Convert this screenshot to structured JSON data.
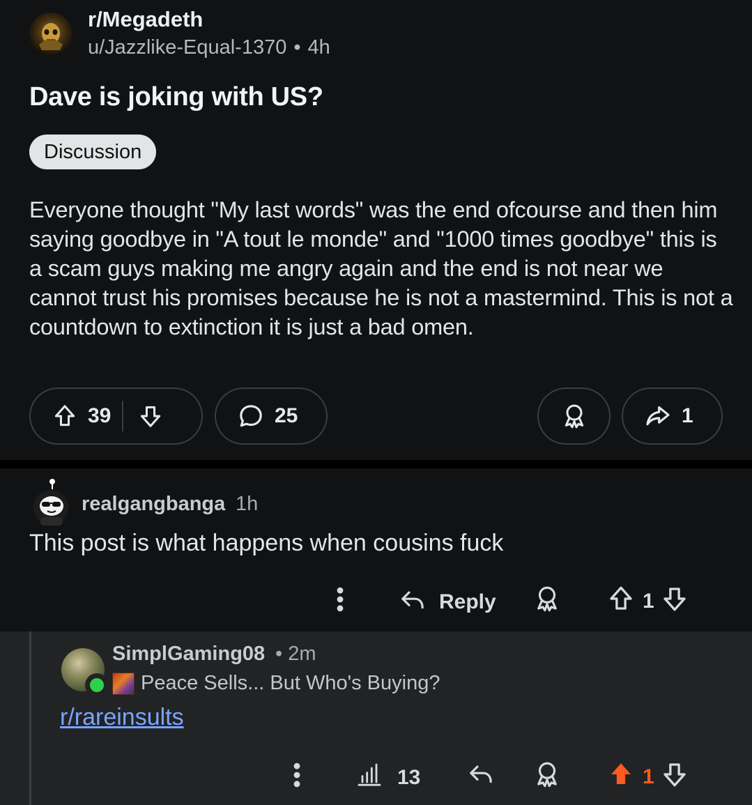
{
  "post": {
    "subreddit": "r/Megadeth",
    "author": "u/Jazzlike-Equal-1370",
    "separator": "•",
    "age": "4h",
    "title": "Dave is joking with US?",
    "flair": "Discussion",
    "body": "Everyone thought \"My last words\" was the end ofcourse and then him saying goodbye in \"A tout le monde\" and \"1000 times goodbye\" this is a scam guys making me angry again and the end is not near we cannot trust his promises because he is not a mastermind. This is not a countdown to extinction it is just a bad omen.",
    "upvotes": "39",
    "comments": "25",
    "shares": "1"
  },
  "comment": {
    "author": "realgangbanga",
    "age": "1h",
    "body": "This post is what happens when cousins fuck",
    "reply_label": "Reply",
    "score": "1"
  },
  "reply": {
    "author": "SimplGaming08",
    "separator": "•",
    "age": "2m",
    "user_flair": "Peace Sells... But Who's Buying?",
    "link_text": "r/rareinsults",
    "views": "13",
    "score": "1",
    "upvoted_color": "#ff5a1f"
  },
  "icons": {
    "upvote": "arrow-up-outline-icon",
    "downvote": "arrow-down-outline-icon",
    "comment": "speech-bubble-icon",
    "award": "award-ribbon-icon",
    "share": "share-arrow-icon",
    "more": "vertical-dots-icon",
    "reply": "reply-arrow-icon",
    "insights": "bar-chart-icon"
  }
}
